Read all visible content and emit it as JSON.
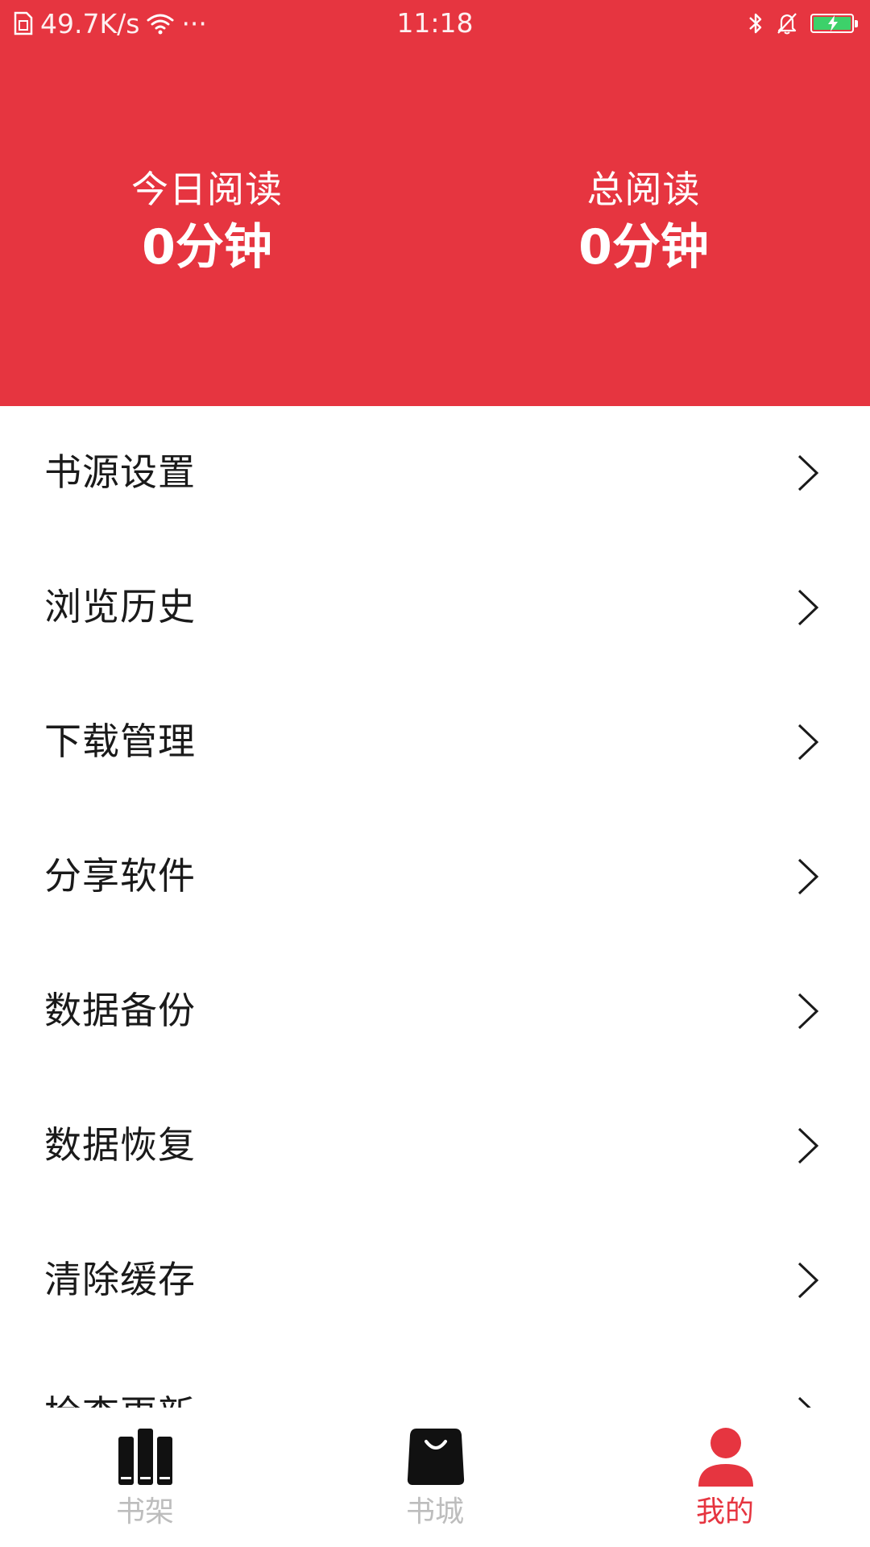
{
  "status_bar": {
    "net_speed": "49.7K/s",
    "more": "···",
    "time": "11:18",
    "battery_level": 1.0
  },
  "colors": {
    "accent": "#e63540",
    "battery_green": "#3dd16a",
    "inactive_tab": "#bdbdbd"
  },
  "stats": {
    "today_label": "今日阅读",
    "today_value": "0分钟",
    "total_label": "总阅读",
    "total_value": "0分钟"
  },
  "menu": {
    "items": [
      {
        "label": "书源设置"
      },
      {
        "label": "浏览历史"
      },
      {
        "label": "下载管理"
      },
      {
        "label": "分享软件"
      },
      {
        "label": "数据备份"
      },
      {
        "label": "数据恢复"
      },
      {
        "label": "清除缓存"
      },
      {
        "label": "检查更新"
      }
    ]
  },
  "bottom_nav": {
    "items": [
      {
        "label": "书架",
        "icon": "bookshelf-icon",
        "active": false
      },
      {
        "label": "书城",
        "icon": "shopping-bag-icon",
        "active": false
      },
      {
        "label": "我的",
        "icon": "user-icon",
        "active": true
      }
    ]
  }
}
